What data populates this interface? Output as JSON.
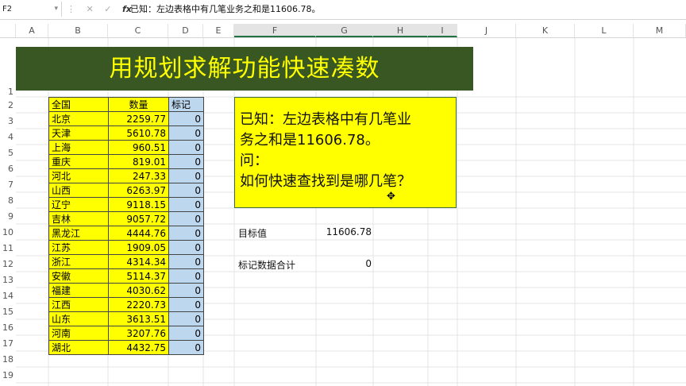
{
  "formula_bar": {
    "cell_ref": "F2",
    "fx": "fx",
    "formula": "已知：左边表格中有几笔业务之和是11606.78。"
  },
  "columns": [
    "A",
    "B",
    "C",
    "D",
    "E",
    "F",
    "G",
    "H",
    "I",
    "J",
    "K",
    "L",
    "M"
  ],
  "rows": [
    "1",
    "2",
    "3",
    "4",
    "5",
    "6",
    "7",
    "8",
    "9",
    "10",
    "11",
    "12",
    "13",
    "14",
    "15",
    "16",
    "17",
    "18",
    "19"
  ],
  "banner": "用规划求解功能快速凑数",
  "table": {
    "headers": [
      "全国",
      "数量",
      "标记"
    ],
    "rows": [
      [
        "北京",
        "2259.77",
        "0"
      ],
      [
        "天津",
        "5610.78",
        "0"
      ],
      [
        "上海",
        "960.51",
        "0"
      ],
      [
        "重庆",
        "819.01",
        "0"
      ],
      [
        "河北",
        "247.33",
        "0"
      ],
      [
        "山西",
        "6263.97",
        "0"
      ],
      [
        "辽宁",
        "9118.15",
        "0"
      ],
      [
        "吉林",
        "9057.72",
        "0"
      ],
      [
        "黑龙江",
        "4444.76",
        "0"
      ],
      [
        "江苏",
        "1909.05",
        "0"
      ],
      [
        "浙江",
        "4314.34",
        "0"
      ],
      [
        "安徽",
        "5114.37",
        "0"
      ],
      [
        "福建",
        "4030.62",
        "0"
      ],
      [
        "江西",
        "2220.73",
        "0"
      ],
      [
        "山东",
        "3613.51",
        "0"
      ],
      [
        "河南",
        "3207.76",
        "0"
      ],
      [
        "湖北",
        "4432.75",
        "0"
      ]
    ]
  },
  "note": {
    "line1": "已知：左边表格中有几笔业",
    "line2": "务之和是11606.78。",
    "line3": "问：",
    "line4": "如何快速查找到是哪几笔？"
  },
  "target": {
    "label": "目标值",
    "value": "11606.78"
  },
  "marked_sum": {
    "label": "标记数据合计",
    "value": "0"
  }
}
